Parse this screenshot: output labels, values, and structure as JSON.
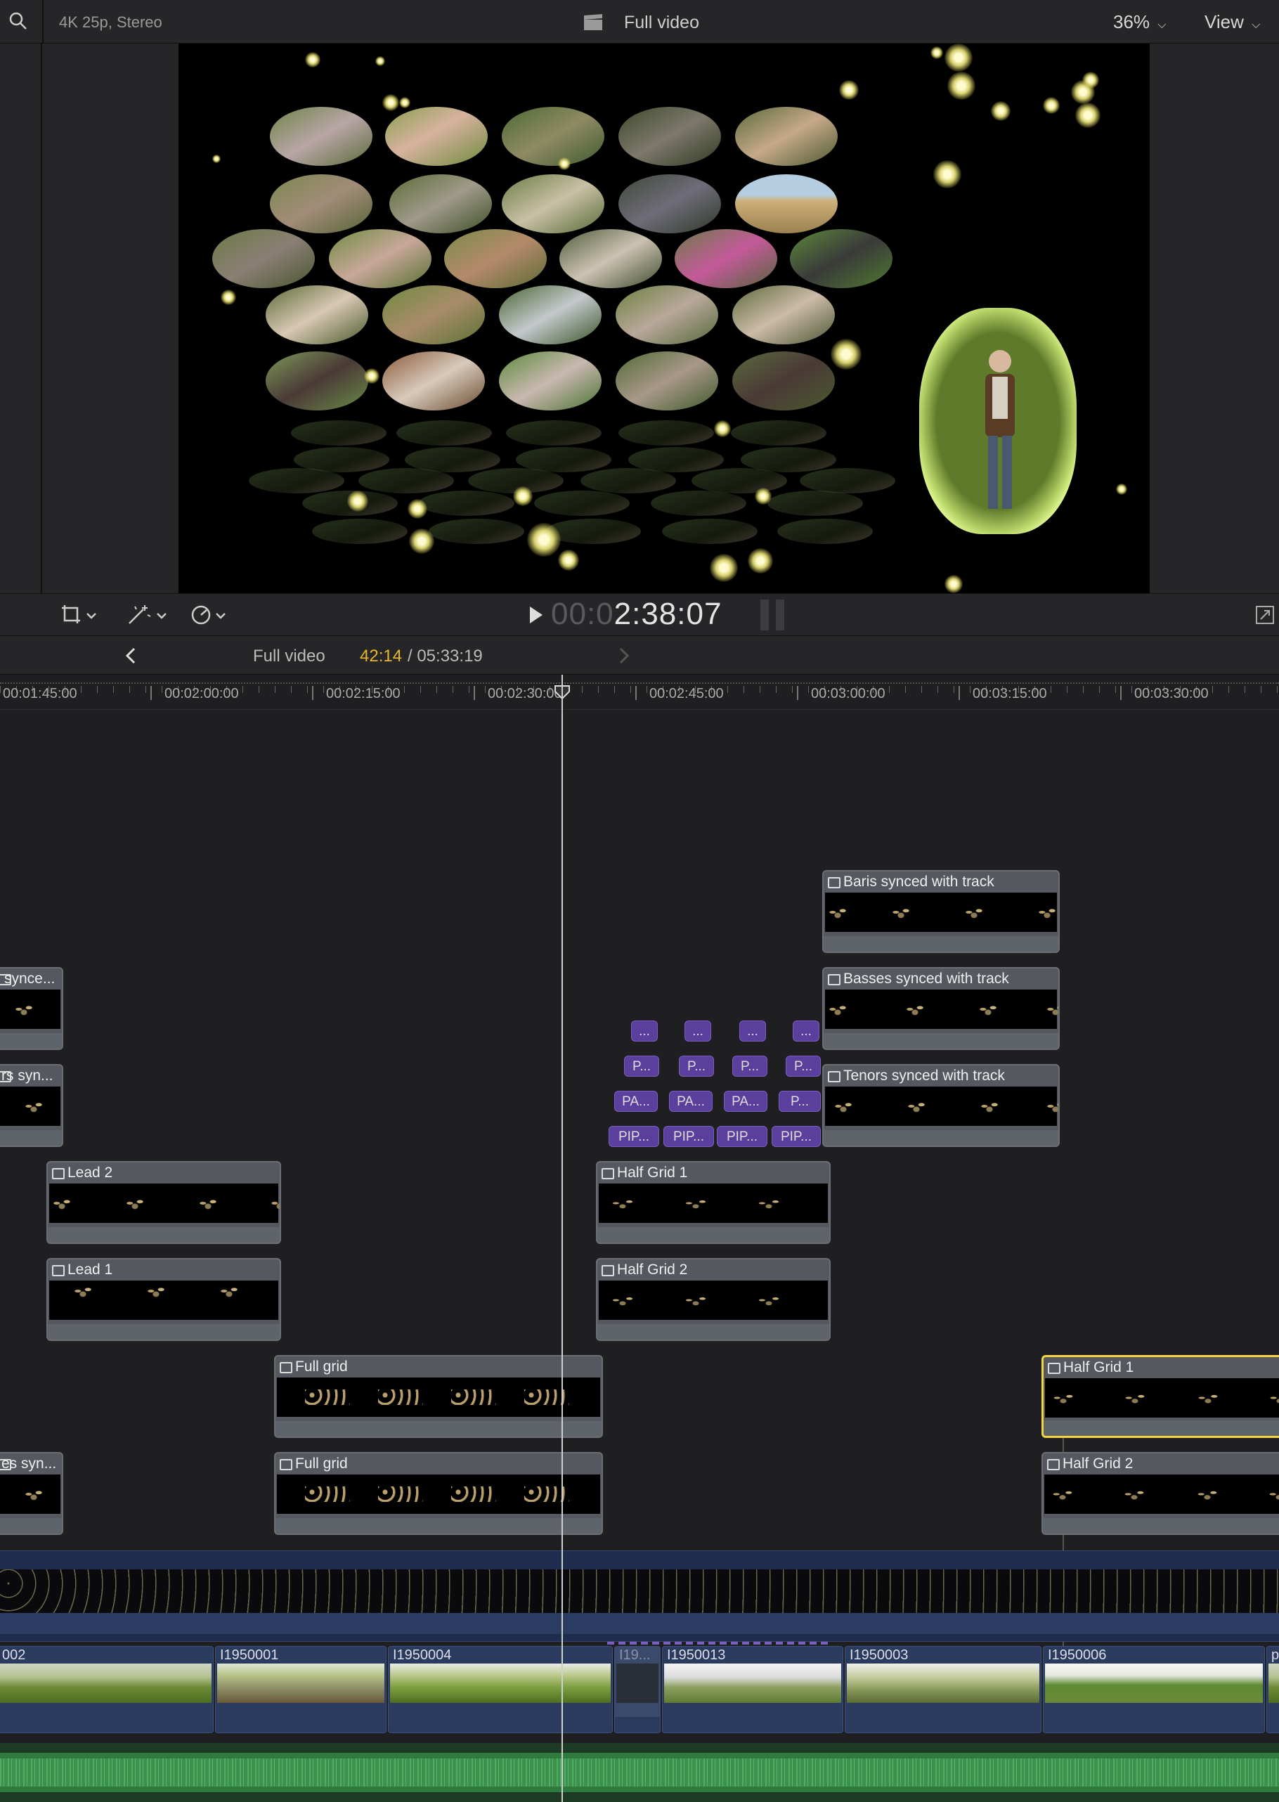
{
  "viewer": {
    "format": "4K 25p, Stereo",
    "title": "Full video",
    "zoom": "36%",
    "view_menu": "View",
    "timecode_dim": "00:0",
    "timecode": "2:38:07"
  },
  "timeline": {
    "project": "Full video",
    "position": "42:14",
    "duration": "/ 05:33:19",
    "ruler": [
      "00:01:45:00",
      "00:02:00:00",
      "00:02:15:00",
      "00:02:30:00",
      "00:02:45:00",
      "00:03:00:00",
      "00:03:15:00",
      "00:03:30:00"
    ],
    "clips": {
      "baris": "Baris synced with track",
      "basses": "Basses synced with track",
      "tenors": "Tenors synced with track",
      "left_synce": "synce...",
      "left_rs_syn": "rs syn...",
      "lead2": "Lead 2",
      "lead1": "Lead 1",
      "half_grid_1": "Half Grid 1",
      "half_grid_2": "Half Grid 2",
      "full_grid_a": "Full grid",
      "full_grid_b": "Full grid",
      "half_grid_1_right": "Half Grid 1",
      "half_grid_2_right": "Half Grid 2",
      "left_es_syn": "es syn..."
    },
    "purple_row1": [
      "...",
      "...",
      "...",
      "..."
    ],
    "purple_row2": [
      "P...",
      "P...",
      "P...",
      "P..."
    ],
    "purple_row3": [
      "PA...",
      "PA...",
      "PA...",
      "P..."
    ],
    "purple_row4": [
      "PIP...",
      "PIP...",
      "PIP...",
      "PIP..."
    ],
    "storyline": [
      "002",
      "I1950001",
      "I1950004",
      "I19...",
      "I1950013",
      "I1950003",
      "I1950006",
      "p"
    ]
  },
  "colors": {
    "selection": "#f5d442",
    "accent_time": "#e8b730",
    "purple": "#5a3f9d",
    "storyline": "#2a3b5d",
    "audio": "#3d8c4a"
  }
}
